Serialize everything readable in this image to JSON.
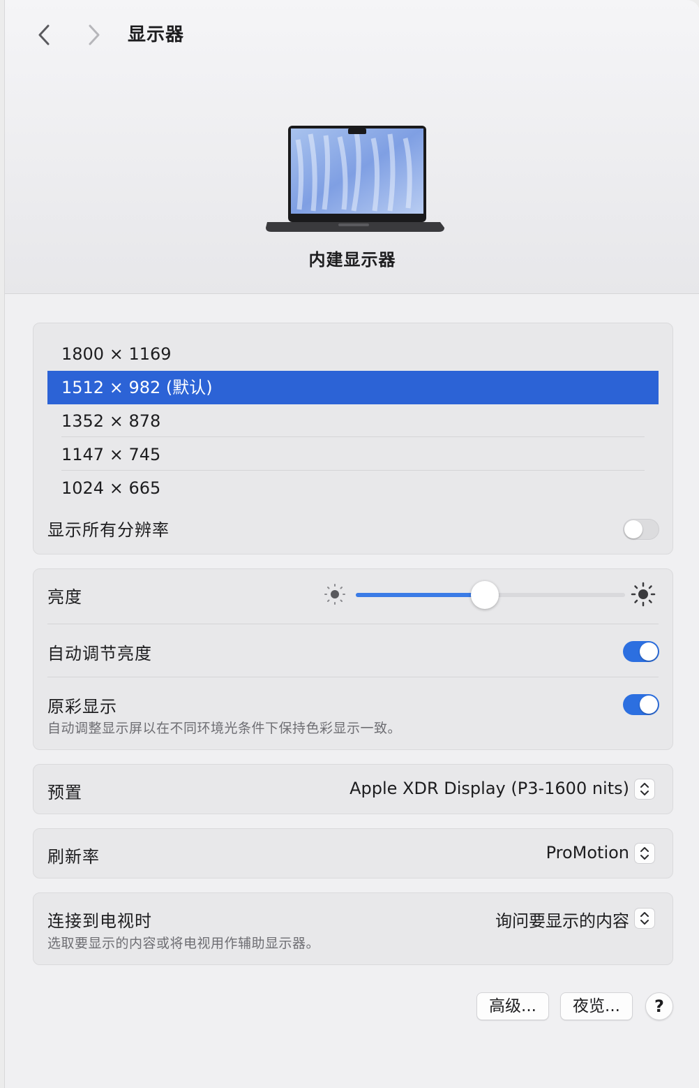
{
  "header": {
    "title": "显示器",
    "display_name": "内建显示器"
  },
  "resolutions": {
    "items": [
      {
        "label": "1800 × 1169",
        "selected": false
      },
      {
        "label": "1512 × 982 (默认)",
        "selected": true
      },
      {
        "label": "1352 × 878",
        "selected": false
      },
      {
        "label": "1147 × 745",
        "selected": false
      },
      {
        "label": "1024 × 665",
        "selected": false
      }
    ],
    "show_all_label": "显示所有分辨率",
    "show_all_on": false
  },
  "brightness": {
    "label": "亮度",
    "value_fraction": 0.48,
    "auto_label": "自动调节亮度",
    "auto_on": true,
    "true_tone_label": "原彩显示",
    "true_tone_desc": "自动调整显示屏以在不同环境光条件下保持色彩显示一致。",
    "true_tone_on": true
  },
  "preset": {
    "label": "预置",
    "value": "Apple XDR Display (P3-1600 nits)"
  },
  "refresh": {
    "label": "刷新率",
    "value": "ProMotion"
  },
  "tv": {
    "label": "连接到电视时",
    "desc": "选取要显示的内容或将电视用作辅助显示器。",
    "value": "询问要显示的内容"
  },
  "buttons": {
    "advanced": "高级...",
    "night_shift": "夜览...",
    "help": "?"
  },
  "colors": {
    "accent": "#2c63d6",
    "toggle_on": "#2c6fe0"
  }
}
